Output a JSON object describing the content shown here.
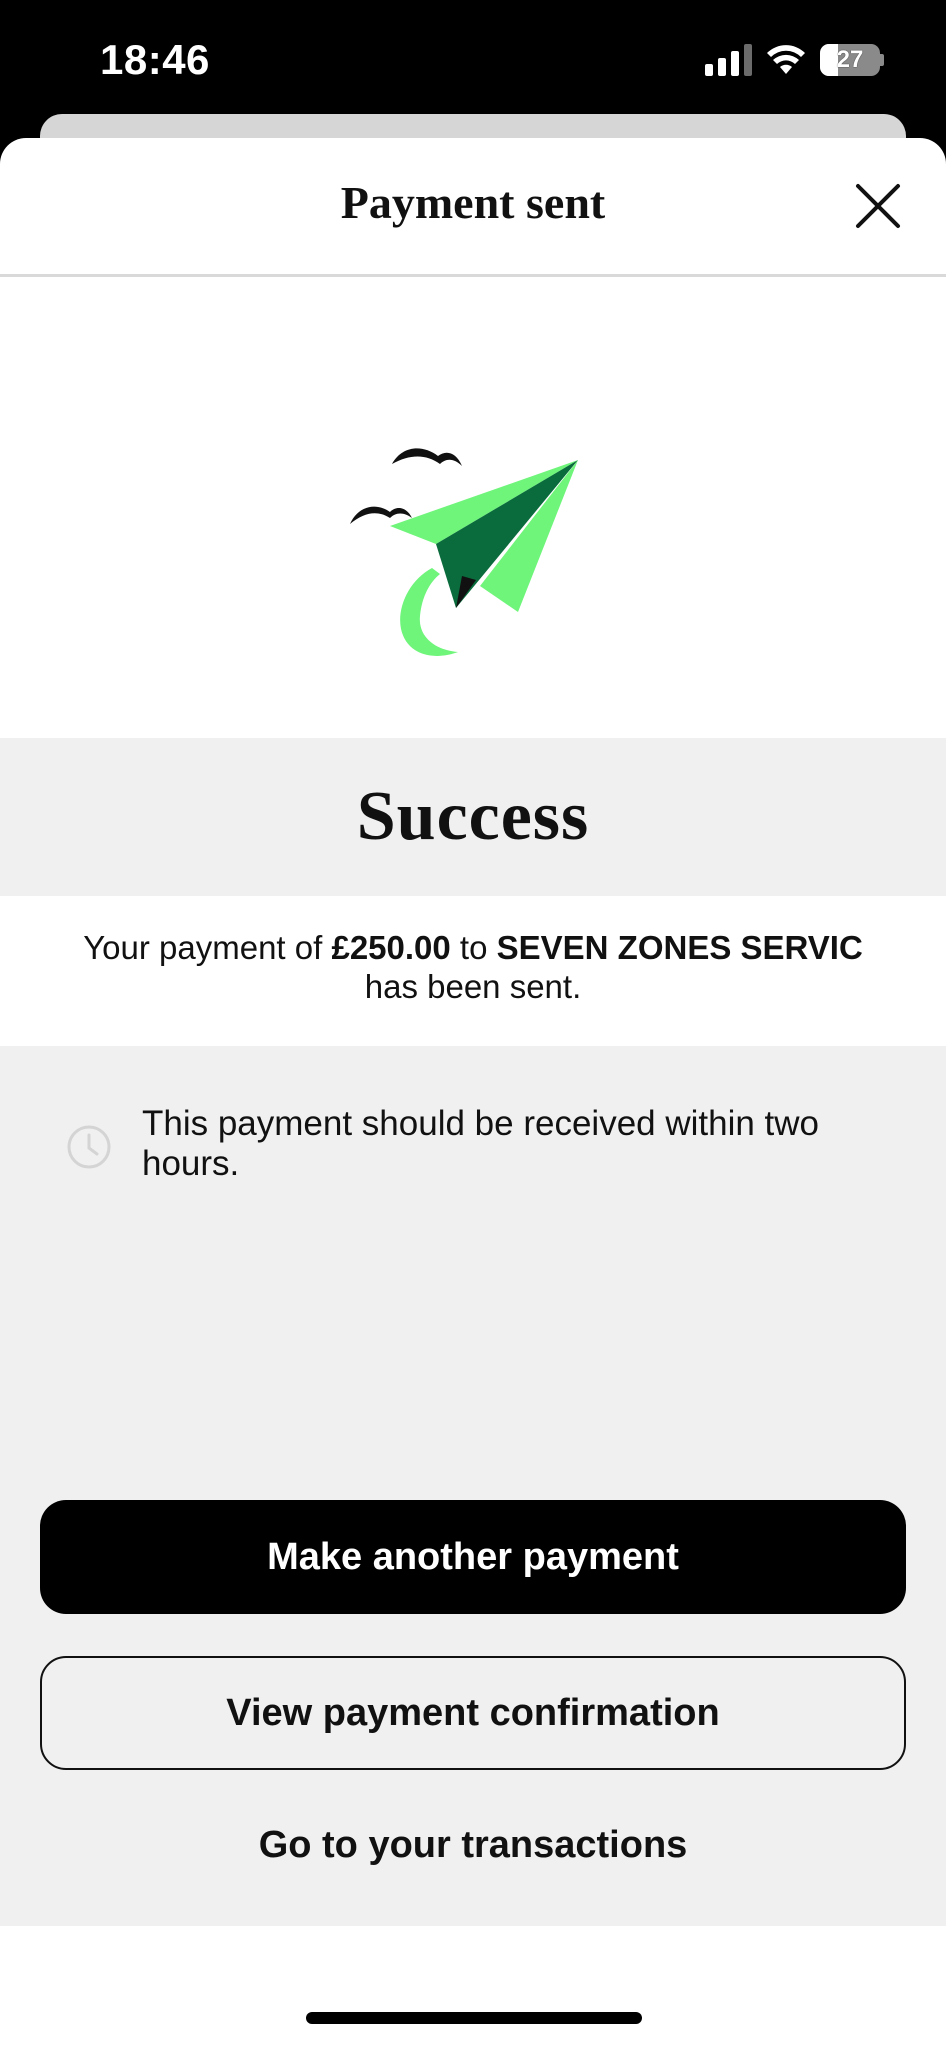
{
  "status_bar": {
    "time": "18:46",
    "battery_level": "27",
    "signal_bars_active": 3,
    "signal_bars_total": 4
  },
  "header": {
    "title": "Payment sent",
    "close_icon": "close-icon"
  },
  "illustration": {
    "icon": "paper-plane-with-birds",
    "colors": {
      "light_green": "#6EF57A",
      "dark_green": "#0A6B3C",
      "bird": "#111111"
    }
  },
  "success": {
    "title": "Success"
  },
  "message": {
    "prefix": "Your payment of ",
    "amount": "£250.00",
    "middle": " to ",
    "payee": "SEVEN ZONES SERVIC",
    "suffix": "has been sent."
  },
  "info": {
    "icon": "clock-icon",
    "text": "This payment should be received within two hours."
  },
  "actions": {
    "primary_label": "Make another payment",
    "secondary_label": "View payment confirmation",
    "link_label": "Go to your transactions"
  },
  "colors": {
    "primary_button_bg": "#000000",
    "band_bg": "#F0F0F0"
  }
}
